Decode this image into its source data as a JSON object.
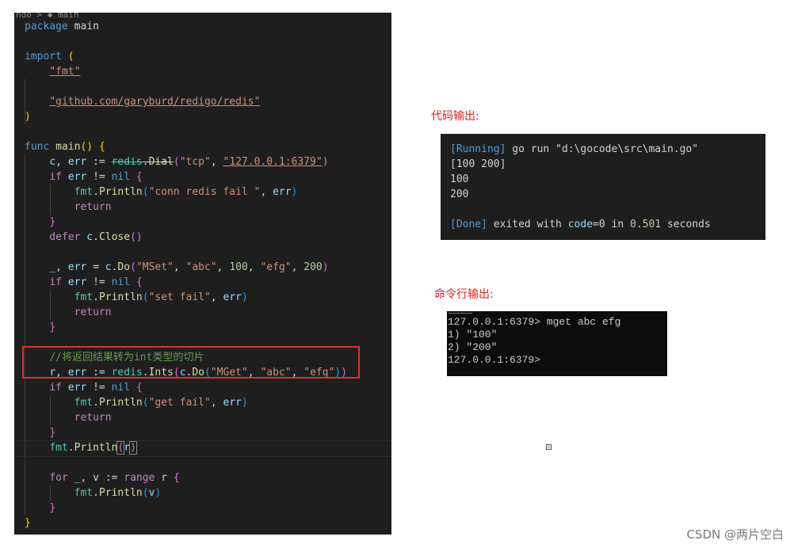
{
  "editor": {
    "breadcrumb": "ngo > ◆ main",
    "lines": [
      [
        {
          "t": "package",
          "c": "kw"
        },
        {
          "t": " main",
          "c": ""
        }
      ],
      [],
      [
        {
          "t": "import",
          "c": "kw"
        },
        {
          "t": " ",
          "c": ""
        },
        {
          "t": "(",
          "c": "brk1"
        }
      ],
      [
        {
          "t": "    ",
          "c": ""
        },
        {
          "t": "\"fmt\"",
          "c": "str uline"
        }
      ],
      [],
      [
        {
          "t": "    ",
          "c": ""
        },
        {
          "t": "\"github.com/garyburd/redigo/redis\"",
          "c": "str uline"
        }
      ],
      [
        {
          "t": ")",
          "c": "brk1"
        }
      ],
      [],
      [
        {
          "t": "func",
          "c": "kw"
        },
        {
          "t": " ",
          "c": ""
        },
        {
          "t": "main",
          "c": "fn"
        },
        {
          "t": "()",
          "c": "brk1"
        },
        {
          "t": " ",
          "c": ""
        },
        {
          "t": "{",
          "c": "brk1"
        }
      ],
      [
        {
          "t": "    ",
          "c": ""
        },
        {
          "t": "c",
          "c": "var"
        },
        {
          "t": ", ",
          "c": ""
        },
        {
          "t": "err",
          "c": "var"
        },
        {
          "t": " := ",
          "c": ""
        },
        {
          "t": "redis",
          "c": "pkg strike"
        },
        {
          "t": ".",
          "c": "strike"
        },
        {
          "t": "Dial",
          "c": "fn strike"
        },
        {
          "t": "(",
          "c": "brk2"
        },
        {
          "t": "\"tcp\"",
          "c": "str"
        },
        {
          "t": ", ",
          "c": ""
        },
        {
          "t": "\"127.0.0.1:6379\"",
          "c": "str uline"
        },
        {
          "t": ")",
          "c": "brk2"
        }
      ],
      [
        {
          "t": "    ",
          "c": ""
        },
        {
          "t": "if",
          "c": "ctl"
        },
        {
          "t": " ",
          "c": ""
        },
        {
          "t": "err",
          "c": "var"
        },
        {
          "t": " != ",
          "c": ""
        },
        {
          "t": "nil",
          "c": "kw"
        },
        {
          "t": " ",
          "c": ""
        },
        {
          "t": "{",
          "c": "brk2"
        }
      ],
      [
        {
          "t": "        ",
          "c": ""
        },
        {
          "t": "fmt",
          "c": "pkg"
        },
        {
          "t": ".",
          "c": ""
        },
        {
          "t": "Println",
          "c": "fn"
        },
        {
          "t": "(",
          "c": "brk3"
        },
        {
          "t": "\"conn redis fail \"",
          "c": "str"
        },
        {
          "t": ", ",
          "c": ""
        },
        {
          "t": "err",
          "c": "var"
        },
        {
          "t": ")",
          "c": "brk3"
        }
      ],
      [
        {
          "t": "        ",
          "c": ""
        },
        {
          "t": "return",
          "c": "ctl"
        }
      ],
      [
        {
          "t": "    ",
          "c": ""
        },
        {
          "t": "}",
          "c": "brk2"
        }
      ],
      [
        {
          "t": "    ",
          "c": ""
        },
        {
          "t": "defer",
          "c": "ctl"
        },
        {
          "t": " ",
          "c": ""
        },
        {
          "t": "c",
          "c": "var"
        },
        {
          "t": ".",
          "c": ""
        },
        {
          "t": "Close",
          "c": "fn"
        },
        {
          "t": "()",
          "c": "brk2"
        }
      ],
      [],
      [
        {
          "t": "    ",
          "c": ""
        },
        {
          "t": "_",
          "c": "var"
        },
        {
          "t": ", ",
          "c": ""
        },
        {
          "t": "err",
          "c": "var"
        },
        {
          "t": " = ",
          "c": ""
        },
        {
          "t": "c",
          "c": "var"
        },
        {
          "t": ".",
          "c": ""
        },
        {
          "t": "Do",
          "c": "fn"
        },
        {
          "t": "(",
          "c": "brk2"
        },
        {
          "t": "\"MSet\"",
          "c": "str"
        },
        {
          "t": ", ",
          "c": ""
        },
        {
          "t": "\"abc\"",
          "c": "str"
        },
        {
          "t": ", ",
          "c": ""
        },
        {
          "t": "100",
          "c": "num"
        },
        {
          "t": ", ",
          "c": ""
        },
        {
          "t": "\"efg\"",
          "c": "str"
        },
        {
          "t": ", ",
          "c": ""
        },
        {
          "t": "200",
          "c": "num"
        },
        {
          "t": ")",
          "c": "brk2"
        }
      ],
      [
        {
          "t": "    ",
          "c": ""
        },
        {
          "t": "if",
          "c": "ctl"
        },
        {
          "t": " ",
          "c": ""
        },
        {
          "t": "err",
          "c": "var"
        },
        {
          "t": " != ",
          "c": ""
        },
        {
          "t": "nil",
          "c": "kw"
        },
        {
          "t": " ",
          "c": ""
        },
        {
          "t": "{",
          "c": "brk2"
        }
      ],
      [
        {
          "t": "        ",
          "c": ""
        },
        {
          "t": "fmt",
          "c": "pkg"
        },
        {
          "t": ".",
          "c": ""
        },
        {
          "t": "Println",
          "c": "fn"
        },
        {
          "t": "(",
          "c": "brk3"
        },
        {
          "t": "\"set fail\"",
          "c": "str"
        },
        {
          "t": ", ",
          "c": ""
        },
        {
          "t": "err",
          "c": "var"
        },
        {
          "t": ")",
          "c": "brk3"
        }
      ],
      [
        {
          "t": "        ",
          "c": ""
        },
        {
          "t": "return",
          "c": "ctl"
        }
      ],
      [
        {
          "t": "    ",
          "c": ""
        },
        {
          "t": "}",
          "c": "brk2"
        }
      ],
      [],
      [
        {
          "t": "    ",
          "c": ""
        },
        {
          "t": "//将返回结果转为int类型的切片",
          "c": "cmt"
        }
      ],
      [
        {
          "t": "    ",
          "c": ""
        },
        {
          "t": "r",
          "c": "var"
        },
        {
          "t": ", ",
          "c": ""
        },
        {
          "t": "err",
          "c": "var"
        },
        {
          "t": " := ",
          "c": ""
        },
        {
          "t": "redis",
          "c": "pkg"
        },
        {
          "t": ".",
          "c": ""
        },
        {
          "t": "Ints",
          "c": "fn"
        },
        {
          "t": "(",
          "c": "brk2"
        },
        {
          "t": "c",
          "c": "var"
        },
        {
          "t": ".",
          "c": ""
        },
        {
          "t": "Do",
          "c": "fn"
        },
        {
          "t": "(",
          "c": "brk3"
        },
        {
          "t": "\"MGet\"",
          "c": "str"
        },
        {
          "t": ", ",
          "c": ""
        },
        {
          "t": "\"abc\"",
          "c": "str"
        },
        {
          "t": ", ",
          "c": ""
        },
        {
          "t": "\"efg\"",
          "c": "str"
        },
        {
          "t": ")",
          "c": "brk3"
        },
        {
          "t": ")",
          "c": "brk2"
        }
      ],
      [
        {
          "t": "    ",
          "c": ""
        },
        {
          "t": "if",
          "c": "ctl"
        },
        {
          "t": " ",
          "c": ""
        },
        {
          "t": "err",
          "c": "var"
        },
        {
          "t": " != ",
          "c": ""
        },
        {
          "t": "nil",
          "c": "kw"
        },
        {
          "t": " ",
          "c": ""
        },
        {
          "t": "{",
          "c": "brk2"
        }
      ],
      [
        {
          "t": "        ",
          "c": ""
        },
        {
          "t": "fmt",
          "c": "pkg"
        },
        {
          "t": ".",
          "c": ""
        },
        {
          "t": "Println",
          "c": "fn"
        },
        {
          "t": "(",
          "c": "brk3"
        },
        {
          "t": "\"get fail\"",
          "c": "str"
        },
        {
          "t": ", ",
          "c": ""
        },
        {
          "t": "err",
          "c": "var"
        },
        {
          "t": ")",
          "c": "brk3"
        }
      ],
      [
        {
          "t": "        ",
          "c": ""
        },
        {
          "t": "return",
          "c": "ctl"
        }
      ],
      [
        {
          "t": "    ",
          "c": ""
        },
        {
          "t": "}",
          "c": "brk2"
        }
      ],
      [
        {
          "t": "    ",
          "c": ""
        },
        {
          "t": "fmt",
          "c": "pkg"
        },
        {
          "t": ".",
          "c": ""
        },
        {
          "t": "Println",
          "c": "fn"
        },
        {
          "t": "(",
          "c": "brk2 sel-r"
        },
        {
          "t": "r",
          "c": "var"
        },
        {
          "t": ")",
          "c": "brk2 sel-r"
        }
      ],
      [],
      [
        {
          "t": "    ",
          "c": ""
        },
        {
          "t": "for",
          "c": "ctl"
        },
        {
          "t": " ",
          "c": ""
        },
        {
          "t": "_",
          "c": "var"
        },
        {
          "t": ", ",
          "c": ""
        },
        {
          "t": "v",
          "c": "var"
        },
        {
          "t": " := ",
          "c": ""
        },
        {
          "t": "range",
          "c": "ctl"
        },
        {
          "t": " ",
          "c": ""
        },
        {
          "t": "r",
          "c": "var"
        },
        {
          "t": " ",
          "c": ""
        },
        {
          "t": "{",
          "c": "brk2"
        }
      ],
      [
        {
          "t": "        ",
          "c": ""
        },
        {
          "t": "fmt",
          "c": "pkg"
        },
        {
          "t": ".",
          "c": ""
        },
        {
          "t": "Println",
          "c": "fn"
        },
        {
          "t": "(",
          "c": "brk3"
        },
        {
          "t": "v",
          "c": "var"
        },
        {
          "t": ")",
          "c": "brk3"
        }
      ],
      [
        {
          "t": "    ",
          "c": ""
        },
        {
          "t": "}",
          "c": "brk2"
        }
      ],
      [
        {
          "t": "}",
          "c": "brk1"
        }
      ]
    ],
    "current_line": 28
  },
  "labels": {
    "code_output": "代码输出:",
    "cmd_output": "命令行输出:"
  },
  "output_panel": {
    "running_tag": "[Running]",
    "running_cmd": " go run \"d:\\gocode\\src\\main.go\"",
    "lines": [
      "[100 200]",
      "100",
      "200",
      ""
    ],
    "done_tag": "[Done]",
    "done_text": " exited with ",
    "code_key": "code",
    "code_val": "=0",
    "in_text": " in ",
    "time_val": "0.501",
    "seconds": " seconds"
  },
  "cmd_panel": {
    "lines": [
      "127.0.0.1:6379> mget abc efg",
      "1) \"100\"",
      "2) \"200\"",
      "127.0.0.1:6379>"
    ]
  },
  "watermark": "CSDN @两片空白",
  "colors": {
    "label_red": "#e02020",
    "box_red": "#e03030",
    "editor_bg": "#1e1e1e"
  }
}
